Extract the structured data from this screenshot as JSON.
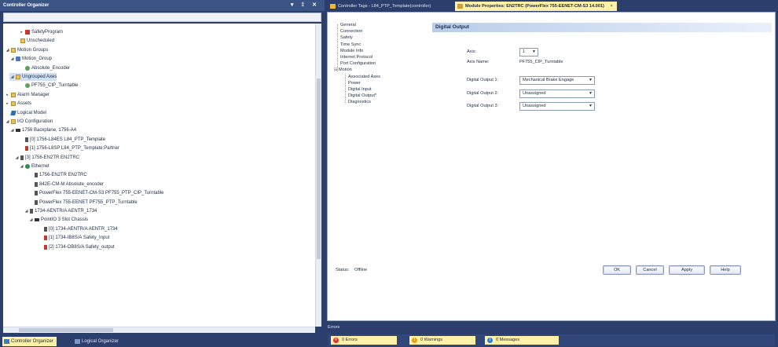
{
  "organizer": {
    "title": "Controller Organizer",
    "title_buttons": "▾ ‡ ✕",
    "tree": [
      {
        "label": "SafetyProgram",
        "icon": "program-icon",
        "indent": 3,
        "expander": "▸"
      },
      {
        "label": "Unscheduled",
        "icon": "folder-icon",
        "indent": 2,
        "expander": ""
      },
      {
        "label": "Motion Groups",
        "icon": "folder-icon",
        "indent": 0,
        "expander": "◢"
      },
      {
        "label": "Motion_Group",
        "icon": "motion-group-icon",
        "indent": 1,
        "expander": "◢"
      },
      {
        "label": "Absolute_Encoder",
        "icon": "axis-icon",
        "indent": 3,
        "expander": ""
      },
      {
        "label": "Ungrouped Axes",
        "icon": "folder-icon",
        "indent": 1,
        "expander": "◢"
      },
      {
        "label": "PF755_CIP_Turntable",
        "icon": "axis-icon",
        "indent": 3,
        "expander": ""
      },
      {
        "label": "Alarm Manager",
        "icon": "folder-icon",
        "indent": 0,
        "expander": "▸"
      },
      {
        "label": "Assets",
        "icon": "folder-icon",
        "indent": 0,
        "expander": "▸"
      },
      {
        "label": "Logical Model",
        "icon": "logical-model-icon",
        "indent": 0,
        "expander": ""
      },
      {
        "label": "I/O Configuration",
        "icon": "folder-icon",
        "indent": 0,
        "expander": "◢"
      },
      {
        "label": "1756 Backplane, 1756-A4",
        "icon": "backplane-icon",
        "indent": 1,
        "expander": "◢"
      },
      {
        "label": "[0] 1756-L84ES L84_PTP_Template",
        "icon": "module-icon",
        "indent": 3,
        "expander": ""
      },
      {
        "label": "[1] 1756-L8SP L84_PTP_Template:Partner",
        "icon": "safety-module-icon",
        "indent": 3,
        "expander": ""
      },
      {
        "label": "[3] 1756-EN2TR EN2TRC",
        "icon": "module-icon",
        "indent": 2,
        "expander": "◢"
      },
      {
        "label": "Ethernet",
        "icon": "ethernet-icon",
        "indent": 3,
        "expander": "◢"
      },
      {
        "label": "1756-EN2TR EN2TRC",
        "icon": "module-icon",
        "indent": 5,
        "expander": ""
      },
      {
        "label": "842E-CM-M Absolute_encoder",
        "icon": "module-icon",
        "indent": 5,
        "expander": ""
      },
      {
        "label": "PowerFlex 755-EENET-CM-S3 PF755_PTP_CIP_Turntable",
        "icon": "module-icon",
        "indent": 5,
        "expander": ""
      },
      {
        "label": "PowerFlex 755-EENET PF755_PTP_Turntable",
        "icon": "module-icon",
        "indent": 5,
        "expander": ""
      },
      {
        "label": "1734-AENTR/A AENTR_1734",
        "icon": "module-icon",
        "indent": 4,
        "expander": "◢"
      },
      {
        "label": "PointIO 3 Slot Chassis",
        "icon": "backplane-icon",
        "indent": 5,
        "expander": "◢"
      },
      {
        "label": "[0] 1734-AENTR/A AENTR_1734",
        "icon": "module-icon",
        "indent": 7,
        "expander": ""
      },
      {
        "label": "[1] 1734-IB8S/A Safety_Input",
        "icon": "safety-module-icon",
        "indent": 7,
        "expander": ""
      },
      {
        "label": "[2] 1734-OB8S/A Safety_output",
        "icon": "safety-module-icon",
        "indent": 7,
        "expander": ""
      }
    ],
    "tabs": [
      "Controller Organizer",
      "Logical Organizer"
    ]
  },
  "doc_tabs": [
    {
      "label": "Controller Tags - L84_PTP_Template(controller)",
      "active": false
    },
    {
      "label": "Module Properties: EN2TRC (PowerFlex 755-EENET-CM-S3 14.001)",
      "active": true,
      "close": "×"
    }
  ],
  "module_properties": {
    "categories": [
      {
        "label": "General",
        "indent": 0
      },
      {
        "label": "Connection",
        "indent": 0
      },
      {
        "label": "Safety",
        "indent": 0
      },
      {
        "label": "Time Sync",
        "indent": 0
      },
      {
        "label": "Module Info",
        "indent": 0
      },
      {
        "label": "Internet Protocol",
        "indent": 0
      },
      {
        "label": "Port Configuration",
        "indent": 0
      },
      {
        "label": "Motion",
        "indent": 0,
        "expander": "⊟"
      },
      {
        "label": "Associated Axes",
        "indent": 1
      },
      {
        "label": "Power",
        "indent": 1
      },
      {
        "label": "Digital Input",
        "indent": 1
      },
      {
        "label": "Digital Output*",
        "indent": 1
      },
      {
        "label": "Diagnostics",
        "indent": 1
      }
    ],
    "section_title": "Digital Output",
    "axis_label": "Axis:",
    "axis_value": "1",
    "axis_name_label": "Axis Name:",
    "axis_name_value": "PF755_CIP_Turntable",
    "outputs": [
      {
        "label": "Digital Output 1:",
        "value": "Mechanical Brake Engage"
      },
      {
        "label": "Digital Output 2:",
        "value": "Unassigned"
      },
      {
        "label": "Digital Output 3:",
        "value": "Unassigned"
      }
    ],
    "status_label": "Status:",
    "status_value": "Offline",
    "buttons": {
      "ok": "OK",
      "cancel": "Cancel",
      "apply": "Apply",
      "help": "Help"
    }
  },
  "errors_panel": {
    "title": "Errors",
    "filters": [
      {
        "label": "0 Errors",
        "icon": "error-icon",
        "glyph": "×",
        "color": "#d9342b"
      },
      {
        "label": "0 Warnings",
        "icon": "warning-icon",
        "glyph": "!",
        "color": "#e0a21a"
      },
      {
        "label": "0 Messages",
        "icon": "info-icon",
        "glyph": "i",
        "color": "#2f7fd6"
      }
    ]
  },
  "colors": {
    "frame": "#2c3e6b",
    "active_tab": "#fff2a8",
    "section_header": "#b9cdea"
  }
}
